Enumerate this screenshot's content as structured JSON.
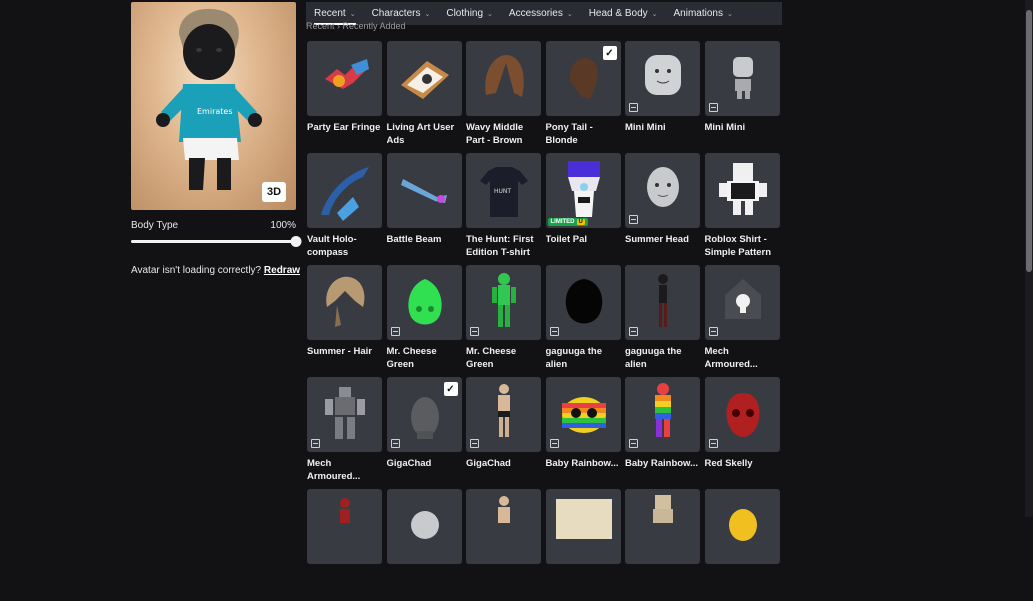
{
  "avatar": {
    "view_toggle": "3D"
  },
  "body_type": {
    "label": "Body Type",
    "value_text": "100%",
    "value": 1.0
  },
  "loading_hint": {
    "text": "Avatar isn't loading correctly?",
    "link": "Redraw"
  },
  "tabs": [
    {
      "label": "Recent",
      "active": true
    },
    {
      "label": "Characters",
      "active": false
    },
    {
      "label": "Clothing",
      "active": false
    },
    {
      "label": "Accessories",
      "active": false
    },
    {
      "label": "Head & Body",
      "active": false
    },
    {
      "label": "Animations",
      "active": false
    }
  ],
  "breadcrumb": "Recent › Recently Added",
  "items": [
    {
      "name": "Party Ear Fringe",
      "icon": "party-ear-fringe",
      "checked": false,
      "corner": false
    },
    {
      "name": "Living Art User Ads",
      "icon": "living-art",
      "checked": false,
      "corner": false
    },
    {
      "name": "Wavy Middle Part - Brown",
      "icon": "wavy-hair",
      "checked": false,
      "corner": false
    },
    {
      "name": "Pony Tail - Blonde",
      "icon": "ponytail",
      "checked": true,
      "corner": false
    },
    {
      "name": "Mini Mini",
      "icon": "mini-head",
      "checked": false,
      "corner": true
    },
    {
      "name": "Mini Mini",
      "icon": "mini-body",
      "checked": false,
      "corner": true
    },
    {
      "name": "Vault Holo-compass",
      "icon": "holo-compass",
      "checked": false,
      "corner": false
    },
    {
      "name": "Battle Beam",
      "icon": "battle-beam",
      "checked": false,
      "corner": false
    },
    {
      "name": "The Hunt: First Edition T-shirt",
      "icon": "tshirt",
      "checked": false,
      "corner": false
    },
    {
      "name": "Toilet Pal",
      "icon": "toilet-pal",
      "checked": false,
      "corner": false,
      "limited": "LIMITED",
      "limited_tag": "U"
    },
    {
      "name": "Summer Head",
      "icon": "summer-head",
      "checked": false,
      "corner": true
    },
    {
      "name": "Roblox Shirt - Simple Pattern",
      "icon": "roblox-shirt",
      "checked": false,
      "corner": false
    },
    {
      "name": "Summer - Hair",
      "icon": "summer-hair",
      "checked": false,
      "corner": false
    },
    {
      "name": "Mr. Cheese Green",
      "icon": "cheese-head",
      "checked": false,
      "corner": true
    },
    {
      "name": "Mr. Cheese Green",
      "icon": "cheese-body",
      "checked": false,
      "corner": true
    },
    {
      "name": "gaguuga the alien",
      "icon": "alien-head",
      "checked": false,
      "corner": true
    },
    {
      "name": "gaguuga the alien",
      "icon": "alien-body",
      "checked": false,
      "corner": true
    },
    {
      "name": "Mech Armoured...",
      "icon": "mech-head",
      "checked": false,
      "corner": true
    },
    {
      "name": "Mech Armoured...",
      "icon": "mech-body",
      "checked": false,
      "corner": true
    },
    {
      "name": "GigaChad",
      "icon": "gigachad-head",
      "checked": true,
      "corner": true
    },
    {
      "name": "GigaChad",
      "icon": "gigachad-body",
      "checked": false,
      "corner": true
    },
    {
      "name": "Baby Rainbow...",
      "icon": "rainbow-head",
      "checked": false,
      "corner": true
    },
    {
      "name": "Baby Rainbow...",
      "icon": "rainbow-body",
      "checked": false,
      "corner": true
    },
    {
      "name": "Red Skelly",
      "icon": "red-skull",
      "checked": false,
      "corner": true
    },
    {
      "name": "",
      "icon": "red-figure",
      "checked": false,
      "corner": false
    },
    {
      "name": "",
      "icon": "grey-head",
      "checked": false,
      "corner": false
    },
    {
      "name": "",
      "icon": "tan-figure",
      "checked": false,
      "corner": false
    },
    {
      "name": "",
      "icon": "beige-block",
      "checked": false,
      "corner": false
    },
    {
      "name": "",
      "icon": "blocky-figure",
      "checked": false,
      "corner": false
    },
    {
      "name": "",
      "icon": "yellow-egg",
      "checked": false,
      "corner": false
    }
  ],
  "colors": {
    "background": "#121215",
    "tile": "#393b43",
    "tab_bar": "#2a2c33",
    "limited": "#18a34b"
  }
}
